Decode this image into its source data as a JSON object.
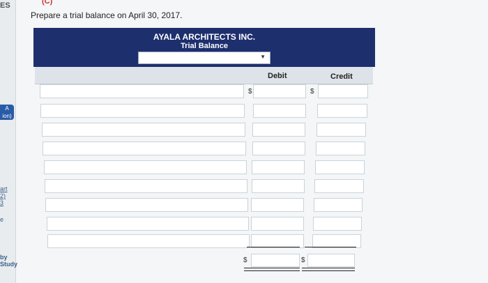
{
  "page": {
    "left_strip": {
      "top_text": "ES",
      "badge_line1": "A",
      "badge_line2": "ion)",
      "link1": "art",
      "link1b": "2)",
      "link1c": "3",
      "link2": "e",
      "study": "by Study"
    },
    "red_mark": "(C)",
    "prompt": "Prepare a trial balance on April 30, 2017."
  },
  "trial_balance": {
    "company": "AYALA ARCHITECTS INC.",
    "title": "Trial Balance",
    "date_selected": "",
    "date_chevron_icon": "chevron-down-icon",
    "columns": {
      "debit": "Debit",
      "credit": "Credit"
    },
    "currency_symbol": "$",
    "rows": [
      {
        "account": "",
        "debit": "",
        "credit": ""
      },
      {
        "account": "",
        "debit": "",
        "credit": ""
      },
      {
        "account": "",
        "debit": "",
        "credit": ""
      },
      {
        "account": "",
        "debit": "",
        "credit": ""
      },
      {
        "account": "",
        "debit": "",
        "credit": ""
      },
      {
        "account": "",
        "debit": "",
        "credit": ""
      },
      {
        "account": "",
        "debit": "",
        "credit": ""
      },
      {
        "account": "",
        "debit": "",
        "credit": ""
      },
      {
        "account": "",
        "debit": "",
        "credit": ""
      }
    ],
    "totals": {
      "debit": "",
      "credit": ""
    }
  },
  "colors": {
    "header_bg": "#1e2f6e",
    "column_header_bg": "#dde3e8",
    "input_border": "#c9d3db"
  }
}
